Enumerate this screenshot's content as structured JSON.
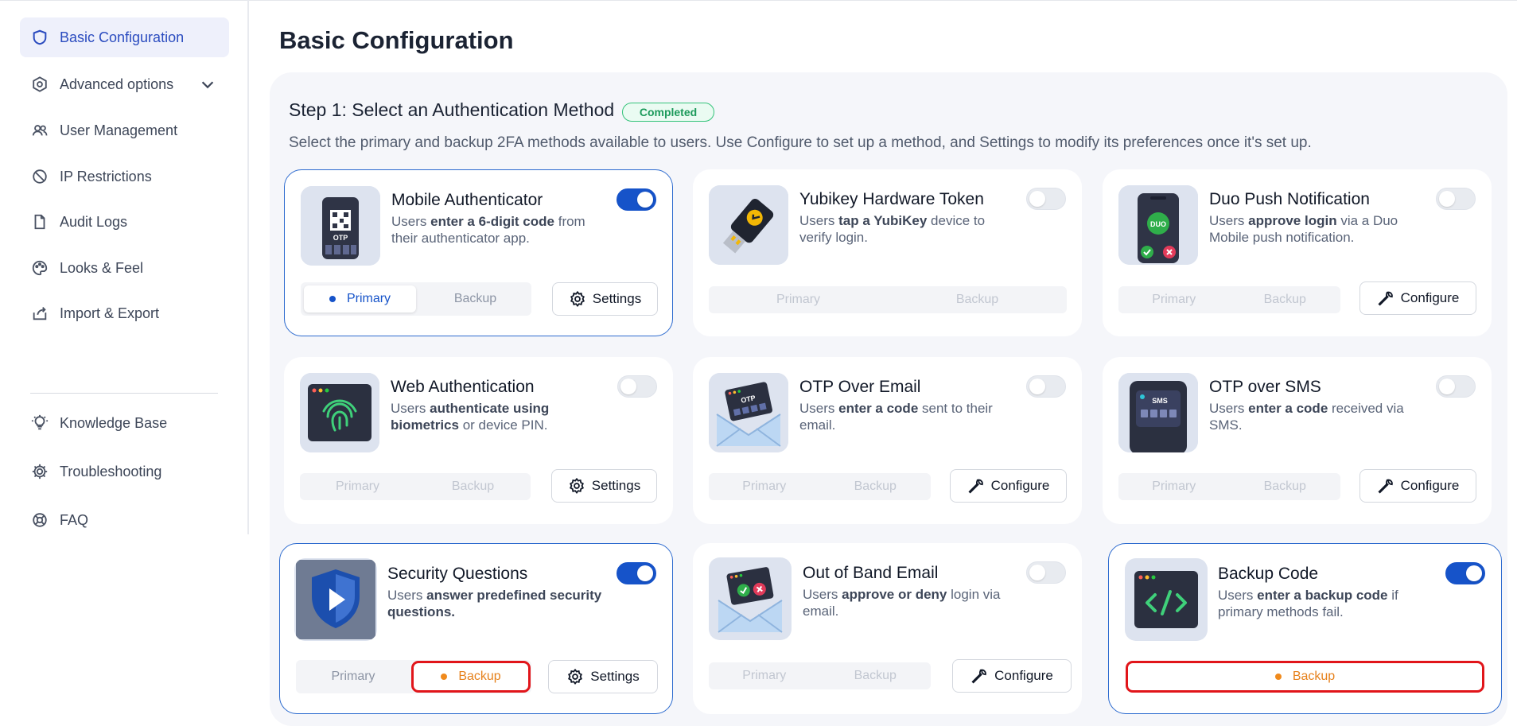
{
  "sidebar": {
    "items": [
      {
        "label": "Basic Configuration",
        "icon": "shield-icon"
      },
      {
        "label": "Advanced options",
        "icon": "hexagon-gear-icon"
      },
      {
        "label": "User Management",
        "icon": "users-icon"
      },
      {
        "label": "IP Restrictions",
        "icon": "ban-icon"
      },
      {
        "label": "Audit Logs",
        "icon": "document-icon"
      },
      {
        "label": "Looks & Feel",
        "icon": "palette-icon"
      },
      {
        "label": "Import & Export",
        "icon": "export-icon"
      },
      {
        "label": "Knowledge Base",
        "icon": "lightbulb-icon"
      },
      {
        "label": "Troubleshooting",
        "icon": "gear-icon"
      },
      {
        "label": "FAQ",
        "icon": "lifebuoy-icon"
      }
    ]
  },
  "page": {
    "title": "Basic Configuration",
    "step_title": "Step 1: Select an Authentication Method",
    "step_badge": "Completed",
    "step_desc": "Select the primary and backup 2FA methods available to users. Use Configure to set up a method, and Settings to modify its preferences once it's set up."
  },
  "labels": {
    "primary": "Primary",
    "backup": "Backup",
    "settings": "Settings",
    "configure": "Configure"
  },
  "colors": {
    "accent": "#1653c9",
    "backup": "#f08a1c",
    "success": "#34c37a",
    "highlight": "#e1151a"
  },
  "cards": [
    {
      "title": "Mobile Authenticator",
      "d1": "Users ",
      "b1": "enter a 6-digit code",
      "d2": " from their authenticator app.",
      "enabled": true,
      "role": "primary",
      "action": "Settings"
    },
    {
      "title": "Yubikey Hardware Token",
      "d1": "Users ",
      "b1": "tap a YubiKey",
      "d2": " device to verify login.",
      "enabled": false,
      "role": "none",
      "action": ""
    },
    {
      "title": "Duo Push Notification",
      "d1": "Users ",
      "b1": "approve login",
      "d2": " via a Duo Mobile push notification.",
      "enabled": false,
      "role": "none",
      "action": "Configure"
    },
    {
      "title": "Web Authentication",
      "d1": "Users ",
      "b1": "authenticate using biometrics",
      "d2": " or device PIN.",
      "enabled": false,
      "role": "none",
      "action": "Settings"
    },
    {
      "title": "OTP Over Email",
      "d1": "Users ",
      "b1": "enter a code",
      "d2": " sent to their email.",
      "enabled": false,
      "role": "none",
      "action": "Configure"
    },
    {
      "title": "OTP over SMS",
      "d1": "Users ",
      "b1": "enter a code",
      "d2": " received via SMS.",
      "enabled": false,
      "role": "none",
      "action": "Configure"
    },
    {
      "title": "Security Questions",
      "d1": "Users ",
      "b1": "answer predefined security questions.",
      "d2": "",
      "enabled": true,
      "role": "backup",
      "action": "Settings"
    },
    {
      "title": "Out of Band Email",
      "d1": "Users ",
      "b1": "approve or deny",
      "d2": " login via email.",
      "enabled": false,
      "role": "none",
      "action": "Configure"
    },
    {
      "title": "Backup Code",
      "d1": "Users ",
      "b1": "enter a backup code",
      "d2": " if primary methods fail.",
      "enabled": true,
      "role": "backup-only",
      "action": ""
    }
  ],
  "thumb_text": {
    "otp": "OTP",
    "sms": "SMS",
    "duo": "DUO"
  }
}
